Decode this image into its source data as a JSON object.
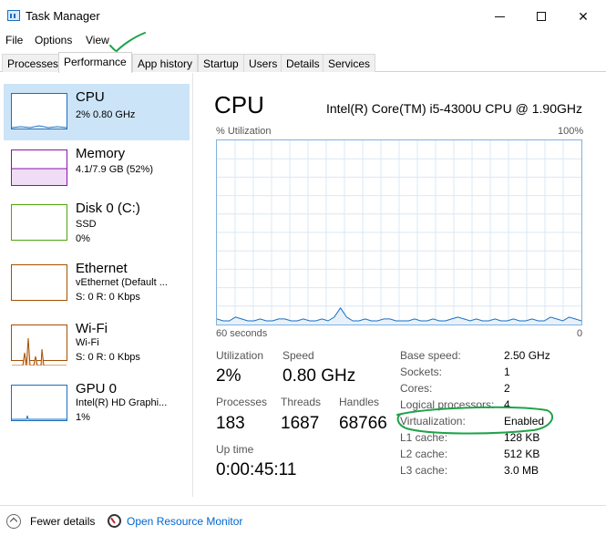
{
  "window": {
    "title": "Task Manager",
    "minimize_glyph": "—",
    "close_glyph": "✕"
  },
  "menu": [
    "File",
    "Options",
    "View"
  ],
  "tabs": [
    {
      "label": "Processes",
      "active": false
    },
    {
      "label": "Performance",
      "active": true
    },
    {
      "label": "App history",
      "active": false
    },
    {
      "label": "Startup",
      "active": false
    },
    {
      "label": "Users",
      "active": false
    },
    {
      "label": "Details",
      "active": false
    },
    {
      "label": "Services",
      "active": false
    }
  ],
  "sidebar": {
    "items": [
      {
        "title": "CPU",
        "line1": "2% 0.80 GHz",
        "line2": "",
        "color": "#1a6fc0",
        "selected": true
      },
      {
        "title": "Memory",
        "line1": "4.1/7.9 GB (52%)",
        "line2": "",
        "color": "#8b12ae",
        "selected": false
      },
      {
        "title": "Disk 0 (C:)",
        "line1": "SSD",
        "line2": "0%",
        "color": "#4da60c",
        "selected": false
      },
      {
        "title": "Ethernet",
        "line1": "vEthernet (Default ...",
        "line2": "S: 0 R: 0 Kbps",
        "color": "#a74f01",
        "selected": false
      },
      {
        "title": "Wi-Fi",
        "line1": "Wi-Fi",
        "line2": "S: 0 R: 0 Kbps",
        "color": "#a74f01",
        "selected": false
      },
      {
        "title": "GPU 0",
        "line1": "Intel(R) HD Graphi...",
        "line2": "1%",
        "color": "#1a6fc0",
        "selected": false
      }
    ]
  },
  "main": {
    "title": "CPU",
    "processor": "Intel(R) Core(TM) i5-4300U CPU @ 1.90GHz",
    "graph": {
      "y_label": "% Utilization",
      "y_max_label": "100%",
      "x_left_label": "60 seconds",
      "x_right_label": "0",
      "line_color": "#1a6fc0",
      "grid_color": "#d9e8f5",
      "utilization_series": [
        3,
        2,
        2,
        4,
        3,
        2,
        2,
        3,
        2,
        2,
        3,
        3,
        2,
        2,
        3,
        2,
        2,
        3,
        2,
        4,
        9,
        4,
        2,
        2,
        3,
        2,
        2,
        3,
        3,
        2,
        2,
        2,
        3,
        2,
        2,
        3,
        2,
        2,
        3,
        4,
        3,
        2,
        3,
        2,
        2,
        3,
        2,
        2,
        3,
        2,
        2,
        3,
        2,
        2,
        4,
        3,
        2,
        4,
        3,
        2
      ]
    },
    "stats": {
      "utilization_label": "Utilization",
      "utilization_value": "2%",
      "speed_label": "Speed",
      "speed_value": "0.80 GHz",
      "processes_label": "Processes",
      "processes_value": "183",
      "threads_label": "Threads",
      "threads_value": "1687",
      "handles_label": "Handles",
      "handles_value": "68766",
      "uptime_label": "Up time",
      "uptime_value": "0:00:45:11"
    },
    "specs": [
      {
        "label": "Base speed:",
        "value": "2.50 GHz"
      },
      {
        "label": "Sockets:",
        "value": "1"
      },
      {
        "label": "Cores:",
        "value": "2"
      },
      {
        "label": "Logical processors:",
        "value": "4"
      },
      {
        "label": "Virtualization:",
        "value": "Enabled"
      },
      {
        "label": "L1 cache:",
        "value": "128 KB"
      },
      {
        "label": "L2 cache:",
        "value": "512 KB"
      },
      {
        "label": "L3 cache:",
        "value": "3.0 MB"
      }
    ]
  },
  "footer": {
    "fewer_details": "Fewer details",
    "open_resource_monitor": "Open Resource Monitor"
  },
  "annotations": {
    "color": "#1fa34a"
  }
}
